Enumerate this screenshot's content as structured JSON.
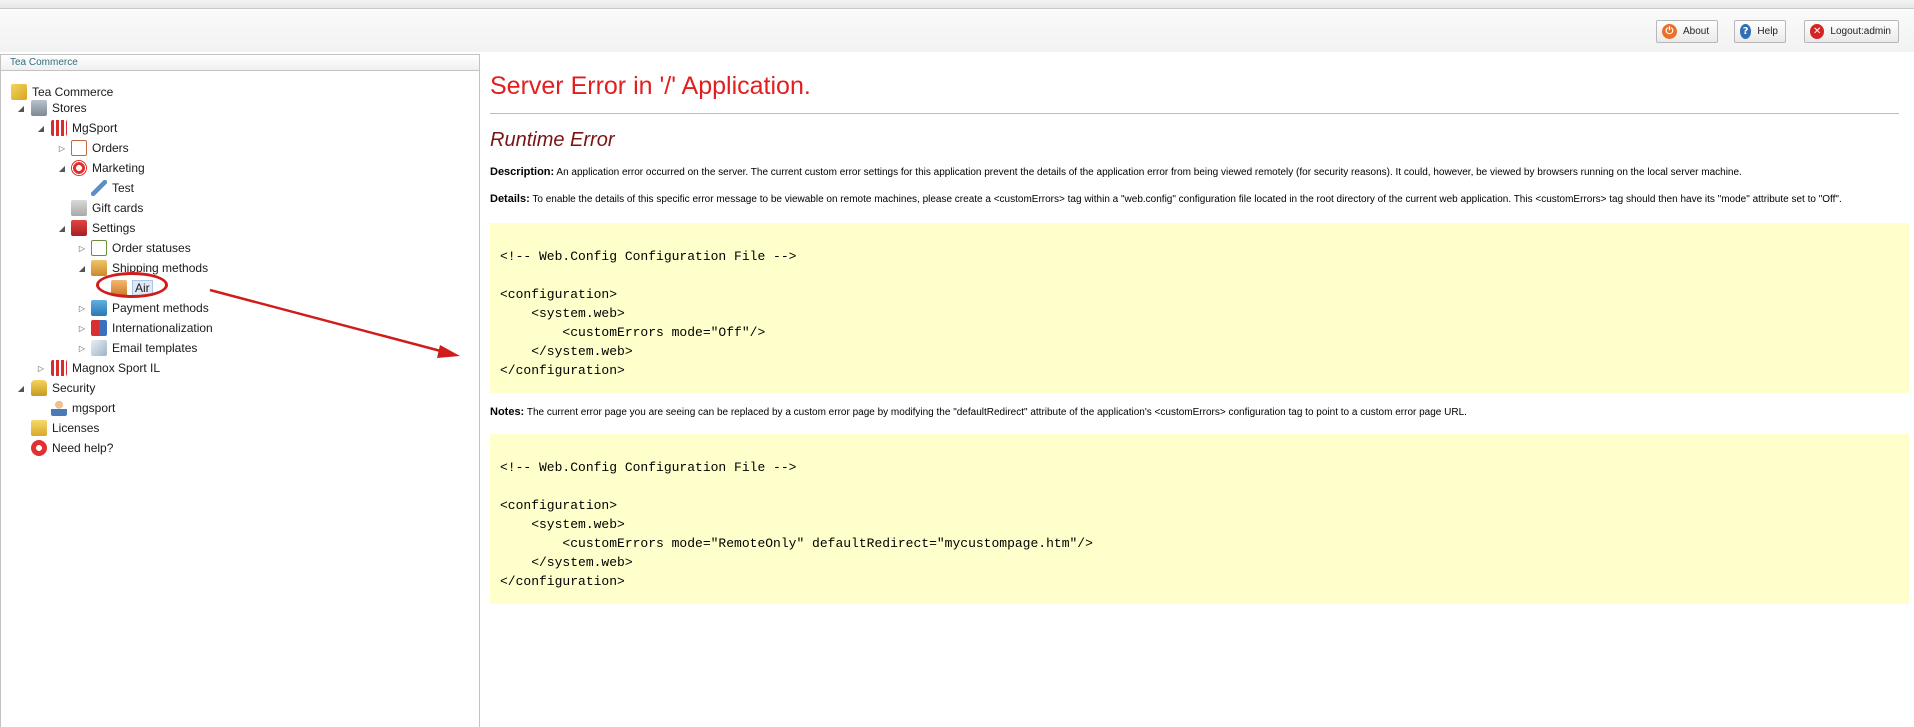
{
  "header": {
    "buttons": [
      {
        "label": "About",
        "icon": "power-icon"
      },
      {
        "label": "Help",
        "icon": "question-icon"
      },
      {
        "label": "Logout:admin",
        "icon": "close-icon"
      }
    ]
  },
  "tree": {
    "title": "Tea Commerce",
    "nodes": {
      "root": "Tea Commerce",
      "stores": "Stores",
      "mgsport": "MgSport",
      "orders": "Orders",
      "marketing": "Marketing",
      "test": "Test",
      "giftcards": "Gift cards",
      "settings": "Settings",
      "orderstatuses": "Order statuses",
      "shipping": "Shipping methods",
      "air": "Air",
      "payment": "Payment methods",
      "intl": "Internationalization",
      "email": "Email templates",
      "magnox": "Magnox Sport IL",
      "security": "Security",
      "mgsportuser": "mgsport",
      "licenses": "Licenses",
      "help": "Need help?"
    }
  },
  "error": {
    "title": "Server Error in '/' Application.",
    "subtitle": "Runtime Error",
    "description_label": "Description:",
    "description": "An application error occurred on the server. The current custom error settings for this application prevent the details of the application error from being viewed remotely (for security reasons). It could, however, be viewed by browsers running on the local server machine.",
    "details_label": "Details:",
    "details": "To enable the details of this specific error message to be viewable on remote machines, please create a <customErrors> tag within a \"web.config\" configuration file located in the root directory of the current web application. This <customErrors> tag should then have its \"mode\" attribute set to \"Off\".",
    "code1": "<!-- Web.Config Configuration File -->\n\n<configuration>\n    <system.web>\n        <customErrors mode=\"Off\"/>\n    </system.web>\n</configuration>",
    "notes_label": "Notes:",
    "notes": "The current error page you are seeing can be replaced by a custom error page by modifying the \"defaultRedirect\" attribute of the application's <customErrors> configuration tag to point to a custom error page URL.",
    "code2": "<!-- Web.Config Configuration File -->\n\n<configuration>\n    <system.web>\n        <customErrors mode=\"RemoteOnly\" defaultRedirect=\"mycustompage.htm\"/>\n    </system.web>\n</configuration>"
  },
  "colors": {
    "error_red": "#e21e1e",
    "code_bg": "#ffffcc",
    "annotation_red": "#d11c1c"
  }
}
